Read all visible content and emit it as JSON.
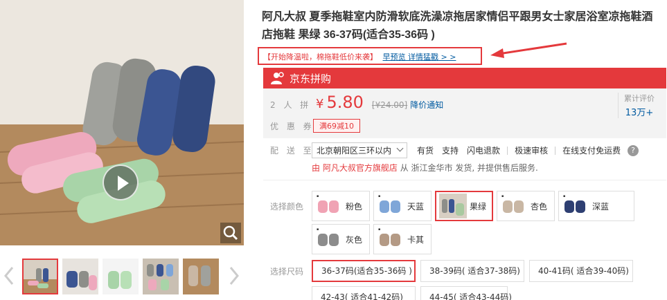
{
  "product": {
    "title": "阿凡大叔 夏季拖鞋室内防滑软底洗澡凉拖居家情侣平跟男女士家居浴室凉拖鞋酒店拖鞋 果绿 36-37码(适合35-36码 )",
    "promo_text": "【开始降温啦，棉拖鞋低价来袭】",
    "promo_link": "早预览 详情猛戳 > >"
  },
  "group_buy": {
    "label": "京东拼购",
    "people_label": "2 人 拼",
    "currency": "¥",
    "price": "5.80",
    "original_price": "[¥24.00]",
    "notify_label": "降价通知",
    "promo_label": "优 惠 券",
    "coupon": "满69减10",
    "review_label": "累计评价",
    "review_count": "13万+"
  },
  "shipping": {
    "label": "配 送 至",
    "region": "北京朝阳区三环以内",
    "services": [
      "有货",
      "支持",
      "闪电退款",
      "极速审核",
      "在线支付免运费"
    ],
    "help_icon": "?",
    "store_prefix": "由",
    "store_name": "阿凡大叔官方旗舰店",
    "store_suffix": "从 浙江金华市 发货, 并提供售后服务."
  },
  "colors": {
    "label": "选择颜色",
    "items": [
      {
        "name": "粉色",
        "color": "#f0a3b4"
      },
      {
        "name": "天蓝",
        "color": "#7fa6d8"
      },
      {
        "name": "果绿",
        "color": "#a9c9a0",
        "selected": true
      },
      {
        "name": "杏色",
        "color": "#c9b7a4"
      },
      {
        "name": "深蓝",
        "color": "#2e3f72"
      },
      {
        "name": "灰色",
        "color": "#8c8c8c"
      },
      {
        "name": "卡其",
        "color": "#b49a85"
      }
    ]
  },
  "sizes": {
    "label": "选择尺码",
    "items": [
      {
        "name": "36-37码(适合35-36码 )",
        "selected": true
      },
      {
        "name": "38-39码( 适合37-38码)"
      },
      {
        "name": "40-41码( 适合39-40码)"
      },
      {
        "name": "42-43( 适合41-42码)"
      },
      {
        "name": "44-45( 适合43-44码)"
      }
    ]
  },
  "ui_colors": {
    "accent": "#e4393c",
    "link": "#005aa0",
    "price_bg": "#f3f3f3"
  },
  "icons": [
    "play-icon",
    "zoom-icon",
    "chevron-left-icon",
    "chevron-right-icon",
    "user-group-icon",
    "arrow-annotation-icon",
    "help-icon"
  ]
}
